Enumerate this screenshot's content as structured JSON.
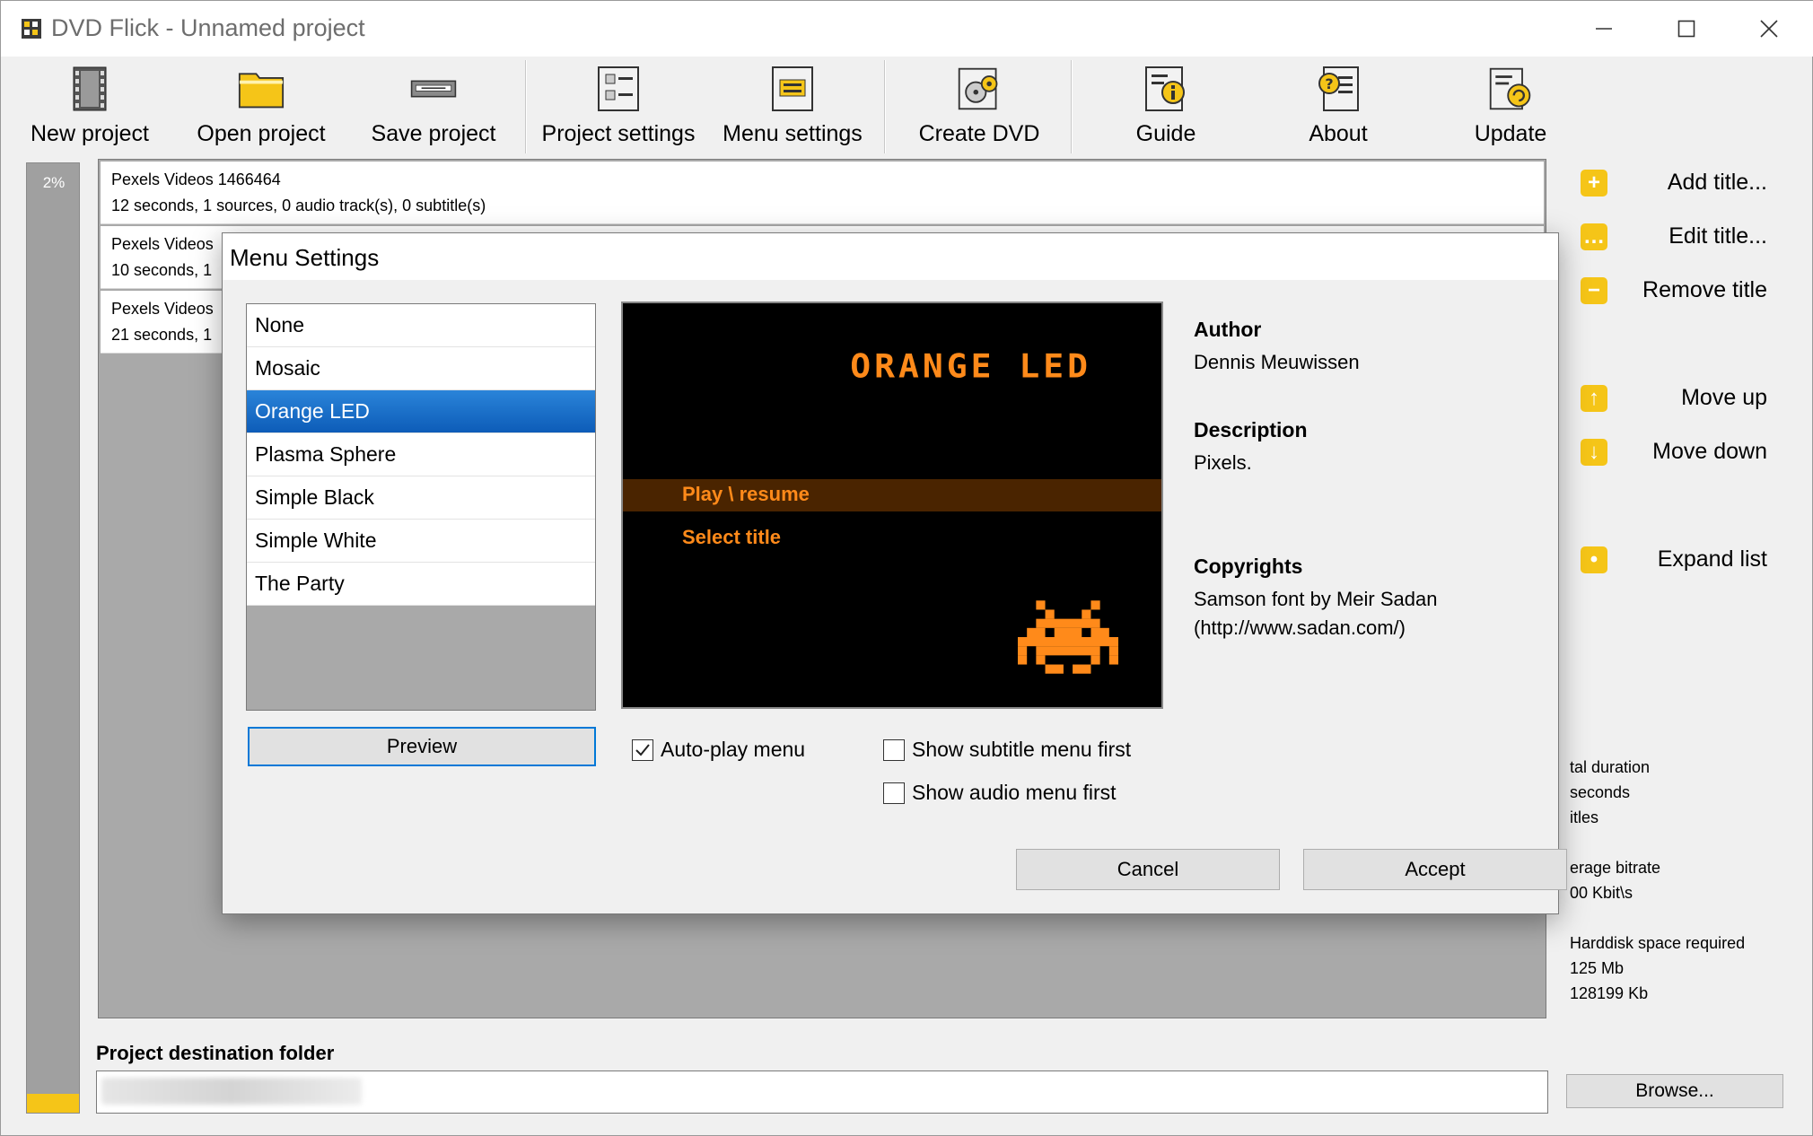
{
  "window": {
    "title": "DVD Flick - Unnamed project"
  },
  "toolbar": {
    "items": [
      {
        "label": "New project",
        "icon": "film-icon"
      },
      {
        "label": "Open project",
        "icon": "folder-icon"
      },
      {
        "label": "Save project",
        "icon": "save-drive-icon"
      },
      {
        "label": "Project settings",
        "icon": "project-settings-icon"
      },
      {
        "label": "Menu settings",
        "icon": "menu-settings-icon"
      },
      {
        "label": "Create DVD",
        "icon": "create-dvd-icon"
      },
      {
        "label": "Guide",
        "icon": "guide-icon"
      },
      {
        "label": "About",
        "icon": "about-icon"
      },
      {
        "label": "Update",
        "icon": "update-icon"
      }
    ]
  },
  "progress": {
    "label": "2%",
    "fraction": 0.02
  },
  "titles": [
    {
      "name": "Pexels Videos 1466464",
      "info": "12 seconds, 1 sources, 0 audio track(s), 0 subtitle(s)"
    },
    {
      "name": "Pexels Videos",
      "info": "10 seconds, 1"
    },
    {
      "name": "Pexels Videos",
      "info": "21 seconds, 1"
    }
  ],
  "side_actions": {
    "add": "Add title...",
    "edit": "Edit title...",
    "remove": "Remove title",
    "up": "Move up",
    "down": "Move down",
    "expand": "Expand list"
  },
  "stats": {
    "duration_label": "tal duration",
    "duration_value": "seconds",
    "titles_label": "itles",
    "bitrate_label": "erage bitrate",
    "bitrate_value": "00 Kbit\\s",
    "disk_label": "Harddisk space required",
    "disk_mb": "125 Mb",
    "disk_kb": "128199 Kb"
  },
  "destination": {
    "label": "Project destination folder",
    "value": "",
    "browse": "Browse..."
  },
  "dialog": {
    "title": "Menu Settings",
    "themes": [
      "None",
      "Mosaic",
      "Orange LED",
      "Plasma Sphere",
      "Simple Black",
      "Simple White",
      "The Party"
    ],
    "selected_theme": "Orange LED",
    "preview_button": "Preview",
    "preview": {
      "title": "ORANGE LED",
      "item1": "Play \\ resume",
      "item2": "Select title"
    },
    "checkboxes": {
      "autoplay": {
        "label": "Auto-play menu",
        "checked": true
      },
      "subtitle_first": {
        "label": "Show subtitle menu first",
        "checked": false
      },
      "audio_first": {
        "label": "Show audio menu first",
        "checked": false
      }
    },
    "info": {
      "author_label": "Author",
      "author_value": "Dennis Meuwissen",
      "description_label": "Description",
      "description_value": "Pixels.",
      "copyrights_label": "Copyrights",
      "copyrights_line1": "Samson font by Meir Sadan",
      "copyrights_line2": "(http://www.sadan.com/)"
    },
    "cancel": "Cancel",
    "accept": "Accept"
  },
  "colors": {
    "accent_yellow": "#f5c518",
    "led_orange": "#ff8a1a",
    "selection_blue": "#0d5cb8"
  }
}
